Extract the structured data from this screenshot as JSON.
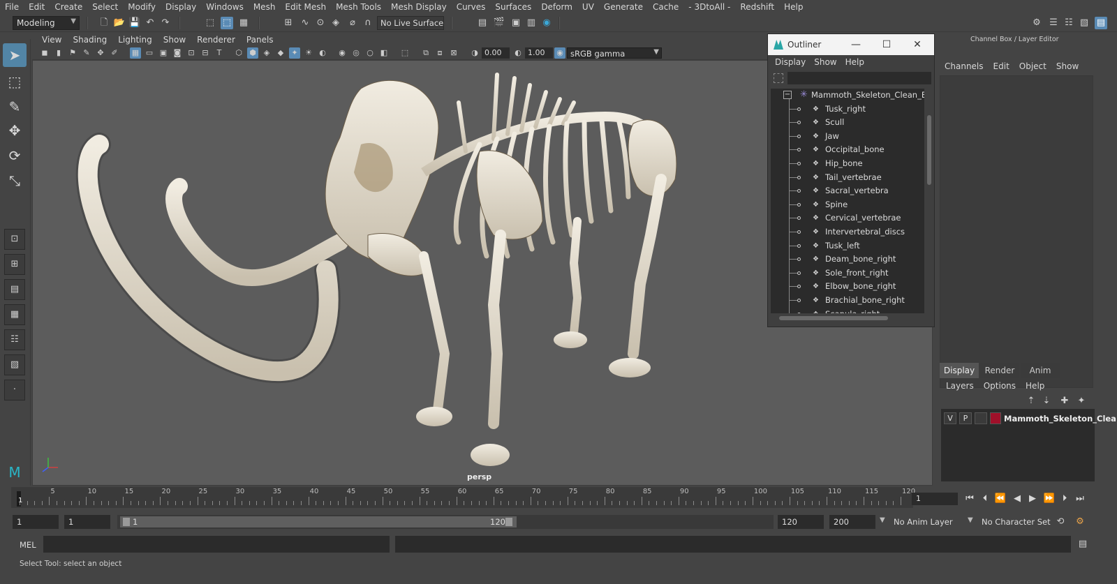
{
  "menubar": {
    "items": [
      "File",
      "Edit",
      "Create",
      "Select",
      "Modify",
      "Display",
      "Windows",
      "Mesh",
      "Edit Mesh",
      "Mesh Tools",
      "Mesh Display",
      "Curves",
      "Surfaces",
      "Deform",
      "UV",
      "Generate",
      "Cache",
      "- 3DtoAll -",
      "Redshift",
      "Help"
    ]
  },
  "statusline": {
    "menu_set": "Modeling",
    "live_surface": "No Live Surface"
  },
  "panel": {
    "menu": [
      "View",
      "Shading",
      "Lighting",
      "Show",
      "Renderer",
      "Panels"
    ],
    "exposure": "0.00",
    "gamma": "1.00",
    "color_space": "sRGB gamma",
    "camera_label": "persp"
  },
  "outliner": {
    "title": "Outliner",
    "menu": [
      "Display",
      "Show",
      "Help"
    ],
    "root": "Mammoth_Skeleton_Clean_Bon",
    "items": [
      "Tusk_right",
      "Scull",
      "Jaw",
      "Occipital_bone",
      "Hip_bone",
      "Tail_vertebrae",
      "Sacral_vertebra",
      "Spine",
      "Cervical_vertebrae",
      "Intervertebral_discs",
      "Tusk_left",
      "Deam_bone_right",
      "Sole_front_right",
      "Elbow_bone_right",
      "Brachial_bone_right",
      "Scapula_right"
    ]
  },
  "channelbox": {
    "title": "Channel Box / Layer Editor",
    "menu": [
      "Channels",
      "Edit",
      "Object",
      "Show"
    ],
    "tabs": [
      "Display",
      "Render",
      "Anim"
    ],
    "layer_menu": [
      "Layers",
      "Options",
      "Help"
    ],
    "layer": {
      "v": "V",
      "p": "P",
      "name": "Mammoth_Skeleton_Clea",
      "color": "#a0102a"
    }
  },
  "timeline": {
    "ticks": [
      "5",
      "10",
      "15",
      "20",
      "25",
      "30",
      "35",
      "40",
      "45",
      "50",
      "55",
      "60",
      "65",
      "70",
      "75",
      "80",
      "85",
      "90",
      "95",
      "100",
      "105",
      "110",
      "115",
      "120"
    ],
    "current_frame_label": "1",
    "current_frame_field": "1"
  },
  "range": {
    "start": "1",
    "playback_start": "1",
    "slider_start": "1",
    "slider_end": "120",
    "playback_end": "120",
    "end": "200",
    "anim_layer": "No Anim Layer",
    "character_set": "No Character Set"
  },
  "commandline": {
    "label": "MEL"
  },
  "helpline": {
    "text": "Select Tool: select an object"
  },
  "colors": {
    "selected_tool": "#5285a6",
    "viewport_bg": "#5c5c5c",
    "layer_color": "#a0102a"
  }
}
